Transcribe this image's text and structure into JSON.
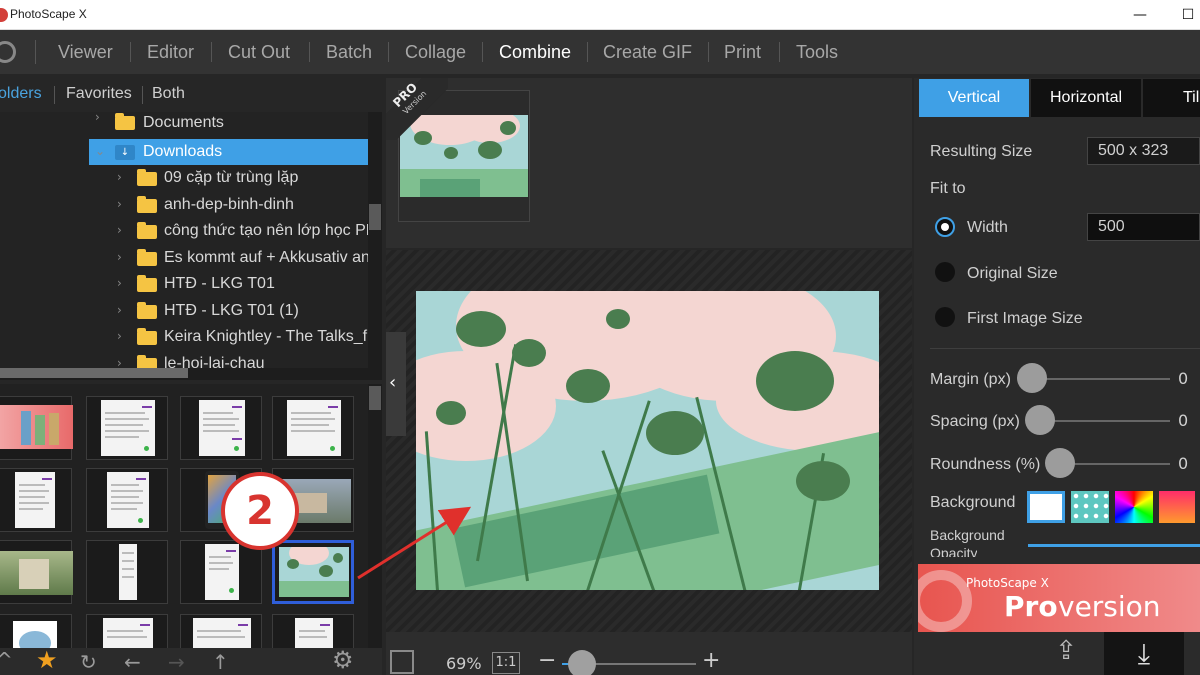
{
  "window": {
    "title": "PhotoScape X",
    "minimize": "—",
    "maximize": "☐"
  },
  "menu": {
    "items": [
      {
        "label": "Viewer",
        "active": false
      },
      {
        "label": "Editor",
        "active": false
      },
      {
        "label": "Cut Out",
        "active": false
      },
      {
        "label": "Batch",
        "active": false
      },
      {
        "label": "Collage",
        "active": false
      },
      {
        "label": "Combine",
        "active": true
      },
      {
        "label": "Create GIF",
        "active": false
      },
      {
        "label": "Print",
        "active": false
      },
      {
        "label": "Tools",
        "active": false
      }
    ]
  },
  "folder_tabs": {
    "folders": "olders",
    "favorites": "Favorites",
    "both": "Both"
  },
  "tree": {
    "items": [
      {
        "label": "Documents",
        "type": "folder"
      },
      {
        "label": "Downloads",
        "type": "downloads",
        "selected": true
      },
      {
        "label": "09 cặp từ trùng lặp",
        "type": "folder"
      },
      {
        "label": "anh-dep-binh-dinh",
        "type": "folder"
      },
      {
        "label": "công thức tạo nên lớp học PN",
        "type": "folder"
      },
      {
        "label": "Es kommt auf + Akkusativ an",
        "type": "folder"
      },
      {
        "label": "HTĐ - LKG T01",
        "type": "folder"
      },
      {
        "label": "HTĐ - LKG T01 (1)",
        "type": "folder"
      },
      {
        "label": "Keira Knightley - The Talks_f",
        "type": "folder"
      },
      {
        "label": "le-hoi-lai-chau",
        "type": "folder"
      }
    ]
  },
  "thumbnails": {
    "items": [
      {
        "kind": "banner"
      },
      {
        "kind": "document"
      },
      {
        "kind": "document"
      },
      {
        "kind": "document"
      },
      {
        "kind": "document"
      },
      {
        "kind": "document"
      },
      {
        "kind": "phone-photo"
      },
      {
        "kind": "photo"
      },
      {
        "kind": "garden"
      },
      {
        "kind": "narrow-doc"
      },
      {
        "kind": "document"
      },
      {
        "kind": "flower-selected"
      },
      {
        "kind": "cartoon"
      },
      {
        "kind": "document"
      },
      {
        "kind": "document"
      },
      {
        "kind": "document"
      }
    ]
  },
  "ribbon": {
    "pro": "PRO",
    "version": "Version"
  },
  "zoom": {
    "percent": "69%",
    "one_to_one": "1:1",
    "minus": "−",
    "plus": "+",
    "level": 0.15
  },
  "mode_tabs": {
    "vertical": "Vertical",
    "horizontal": "Horizontal",
    "tile": "Til"
  },
  "settings": {
    "resulting_size_label": "Resulting Size",
    "resulting_size_value": "500 x 323",
    "fit_to_label": "Fit to",
    "width_label": "Width",
    "width_value": "500",
    "original_size_label": "Original Size",
    "first_image_size_label": "First Image Size",
    "margin_label": "Margin (px)",
    "margin_value": "0",
    "spacing_label": "Spacing (px)",
    "spacing_value": "0",
    "roundness_label": "Roundness (%)",
    "roundness_value": "0",
    "background_label": "Background",
    "background_opacity_line1": "Background",
    "background_opacity_line2": "Opacity"
  },
  "banner": {
    "small": "PhotoScape X",
    "pro": "Pro",
    "version": "version"
  },
  "annotation": {
    "step": "2"
  },
  "colors": {
    "accent": "#3fa0e6",
    "selection": "#2f5ed9",
    "annotation": "#d8342f"
  },
  "icons": {
    "star": "★",
    "rotate": "↻",
    "back": "←",
    "forward": "→",
    "up": "↑",
    "gear": "⚙",
    "chevron_left": "‹",
    "upload": "⇪",
    "download": "⤓"
  }
}
